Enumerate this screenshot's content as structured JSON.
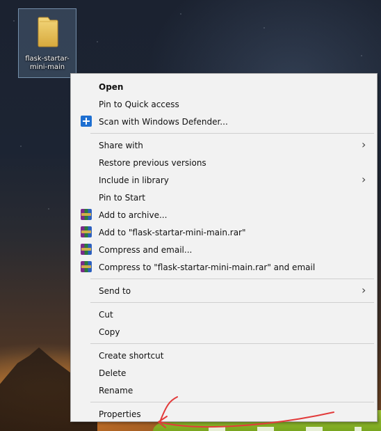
{
  "desktop": {
    "icon": {
      "name": "folder-icon",
      "label": "flask-startar-\nmini-main",
      "colors": {
        "folder": "#e8c65a",
        "selection": "#8cb4dc"
      }
    }
  },
  "context_menu": {
    "items": [
      {
        "type": "item",
        "label": "Open",
        "bold": true,
        "icon": null,
        "submenu": false
      },
      {
        "type": "item",
        "label": "Pin to Quick access",
        "bold": false,
        "icon": null,
        "submenu": false
      },
      {
        "type": "item",
        "label": "Scan with Windows Defender...",
        "bold": false,
        "icon": "windows-defender-icon",
        "submenu": false
      },
      {
        "type": "separator"
      },
      {
        "type": "item",
        "label": "Share with",
        "bold": false,
        "icon": null,
        "submenu": true
      },
      {
        "type": "item",
        "label": "Restore previous versions",
        "bold": false,
        "icon": null,
        "submenu": false
      },
      {
        "type": "item",
        "label": "Include in library",
        "bold": false,
        "icon": null,
        "submenu": true
      },
      {
        "type": "item",
        "label": "Pin to Start",
        "bold": false,
        "icon": null,
        "submenu": false
      },
      {
        "type": "item",
        "label": "Add to archive...",
        "bold": false,
        "icon": "winrar-icon",
        "submenu": false
      },
      {
        "type": "item",
        "label": "Add to \"flask-startar-mini-main.rar\"",
        "bold": false,
        "icon": "winrar-icon",
        "submenu": false
      },
      {
        "type": "item",
        "label": "Compress and email...",
        "bold": false,
        "icon": "winrar-icon",
        "submenu": false
      },
      {
        "type": "item",
        "label": "Compress to \"flask-startar-mini-main.rar\" and email",
        "bold": false,
        "icon": "winrar-icon",
        "submenu": false
      },
      {
        "type": "separator"
      },
      {
        "type": "item",
        "label": "Send to",
        "bold": false,
        "icon": null,
        "submenu": true
      },
      {
        "type": "separator"
      },
      {
        "type": "item",
        "label": "Cut",
        "bold": false,
        "icon": null,
        "submenu": false
      },
      {
        "type": "item",
        "label": "Copy",
        "bold": false,
        "icon": null,
        "submenu": false
      },
      {
        "type": "separator"
      },
      {
        "type": "item",
        "label": "Create shortcut",
        "bold": false,
        "icon": null,
        "submenu": false
      },
      {
        "type": "item",
        "label": "Delete",
        "bold": false,
        "icon": null,
        "submenu": false
      },
      {
        "type": "item",
        "label": "Rename",
        "bold": false,
        "icon": null,
        "submenu": false
      },
      {
        "type": "separator"
      },
      {
        "type": "item",
        "label": "Properties",
        "bold": false,
        "icon": null,
        "submenu": false
      }
    ],
    "colors": {
      "background": "#f2f2f2",
      "border": "#a9a9a9",
      "text": "#111111",
      "annotation_stroke": "#e23b3b"
    }
  }
}
